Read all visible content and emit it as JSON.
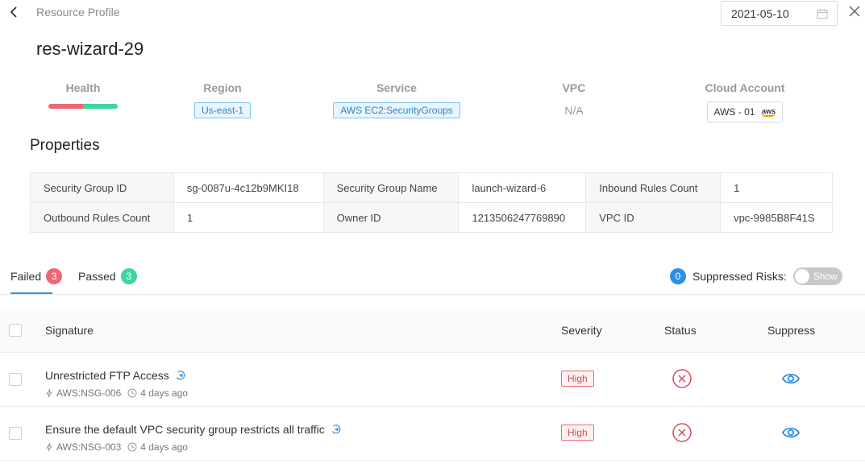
{
  "header": {
    "back_icon": "chevron-left-icon",
    "breadcrumb": "Resource Profile",
    "date": "2021-05-10",
    "calendar_icon": "calendar-icon",
    "close_icon": "close-icon"
  },
  "resource_name": "res-wizard-29",
  "summary": {
    "health": {
      "label": "Health",
      "failed_fraction": 0.5,
      "colors": {
        "failed": "#ee6777",
        "passed": "#3dd69c"
      }
    },
    "region": {
      "label": "Region",
      "value": "Us-east-1"
    },
    "service": {
      "label": "Service",
      "value": "AWS EC2:SecurityGroups"
    },
    "vpc": {
      "label": "VPC",
      "value": "N/A"
    },
    "cloud_account": {
      "label": "Cloud Account",
      "value": "AWS - 01",
      "logo_text": "aws"
    }
  },
  "properties": {
    "title": "Properties",
    "rows": [
      [
        {
          "key": "Security Group ID",
          "value": "sg-0087u-4c12b9MKI18"
        },
        {
          "key": "Security Group Name",
          "value": "launch-wizard-6"
        },
        {
          "key": "Inbound Rules Count",
          "value": "1"
        }
      ],
      [
        {
          "key": "Outbound Rules Count",
          "value": "1"
        },
        {
          "key": "Owner ID",
          "value": "1213506247769890"
        },
        {
          "key": "VPC ID",
          "value": "vpc-9985B8F41S"
        }
      ]
    ]
  },
  "tabs": {
    "failed": {
      "label": "Failed",
      "count": "3"
    },
    "passed": {
      "label": "Passed",
      "count": "3"
    },
    "active": "failed"
  },
  "suppressed": {
    "count": "0",
    "label": "Suppressed Risks:",
    "toggle_label": "Show"
  },
  "results_table": {
    "columns": {
      "signature": "Signature",
      "severity": "Severity",
      "status": "Status",
      "suppress": "Suppress"
    },
    "rows": [
      {
        "signature": "Unrestricted FTP Access",
        "rule": "AWS:NSG-006",
        "age": "4 days ago",
        "severity": "High",
        "status_icon": "failed-x-circle-icon",
        "suppress_icon": "eye-icon"
      },
      {
        "signature": "Ensure the default VPC security group restricts all traffic",
        "rule": "AWS:NSG-003",
        "age": "4 days ago",
        "severity": "High",
        "status_icon": "failed-x-circle-icon",
        "suppress_icon": "eye-icon"
      }
    ]
  },
  "colors": {
    "accent": "#2f8fe6",
    "failed": "#ee6777",
    "passed": "#3dd69c"
  }
}
